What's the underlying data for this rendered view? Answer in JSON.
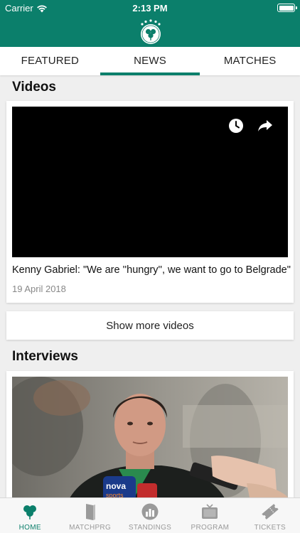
{
  "status_bar": {
    "carrier": "Carrier",
    "time": "2:13 PM"
  },
  "tabs": [
    {
      "label": "FEATURED",
      "active": false
    },
    {
      "label": "NEWS",
      "active": true
    },
    {
      "label": "MATCHES",
      "active": false
    }
  ],
  "videos": {
    "section_title": "Videos",
    "items": [
      {
        "title": "Kenny Gabriel: \"We are ''hungry'', we want to go to Belgrade\"",
        "date": "19 April 2018"
      }
    ],
    "show_more_label": "Show more videos"
  },
  "interviews": {
    "section_title": "Interviews"
  },
  "photo_text": {
    "brand": "nova",
    "sub": "sports"
  },
  "tabbar": [
    {
      "label": "HOME",
      "icon": "shamrock-icon",
      "active": true
    },
    {
      "label": "MATCHPRG",
      "icon": "program-book-icon",
      "active": false
    },
    {
      "label": "STANDINGS",
      "icon": "standings-icon",
      "active": false
    },
    {
      "label": "PROGRAM",
      "icon": "tv-icon",
      "active": false
    },
    {
      "label": "TICKETS",
      "icon": "ticket-icon",
      "active": false
    }
  ],
  "colors": {
    "brand": "#0b7f6b",
    "inactive": "#9a9a9a"
  }
}
